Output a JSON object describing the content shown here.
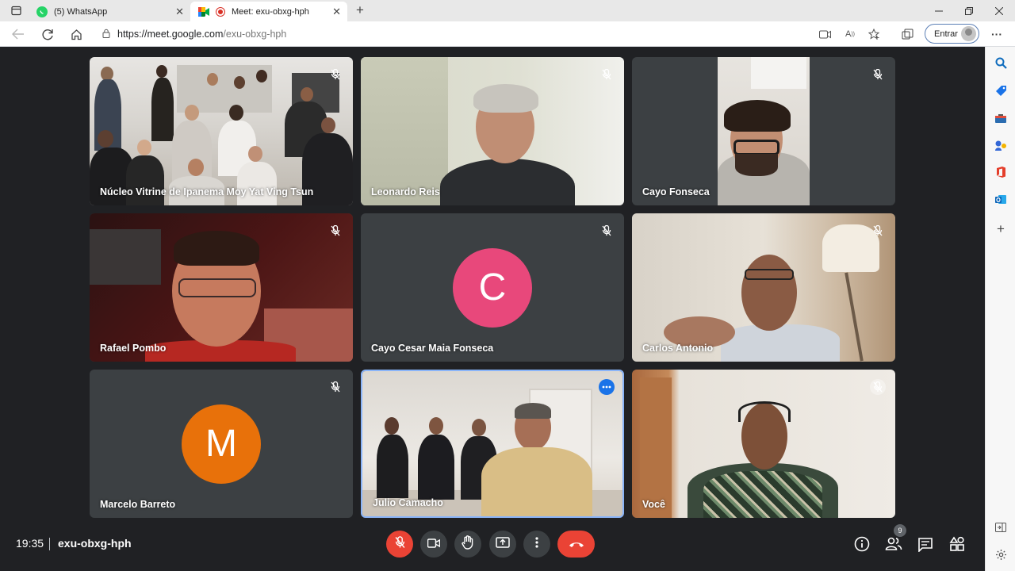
{
  "browser": {
    "tabs": [
      {
        "title": "(5) WhatsApp",
        "active": false
      },
      {
        "title": "Meet: exu-obxg-hph",
        "active": true
      }
    ],
    "url_prefix": "https://meet.google.com",
    "url_rest": "/exu-obxg-hph",
    "signin_label": "Entrar"
  },
  "meet": {
    "participants": [
      {
        "name": "Núcleo Vitrine de Ipanema Moy Yat Ving Tsun",
        "muted": true,
        "video": true
      },
      {
        "name": "Leonardo Reis",
        "muted": true,
        "video": true
      },
      {
        "name": "Cayo Fonseca",
        "muted": true,
        "video": true
      },
      {
        "name": "Rafael Pombo",
        "muted": true,
        "video": true
      },
      {
        "name": "Cayo Cesar Maia Fonseca",
        "muted": true,
        "video": false,
        "initial": "C",
        "avatar_color": "#e8487b"
      },
      {
        "name": "Carlos Antonio",
        "muted": true,
        "video": true
      },
      {
        "name": "Marcelo Barreto",
        "muted": true,
        "video": false,
        "initial": "M",
        "avatar_color": "#e8710a"
      },
      {
        "name": "Julio Camacho",
        "muted": false,
        "video": true,
        "pinned": true
      },
      {
        "name": "Você",
        "muted": true,
        "video": true
      }
    ],
    "time": "19:35",
    "meeting_code": "exu-obxg-hph",
    "participant_count": "9"
  },
  "colors": {
    "meet_bg": "#202124",
    "tile_bg": "#3c4043",
    "red": "#ea4335",
    "accent_blue": "#8ab4f8"
  }
}
